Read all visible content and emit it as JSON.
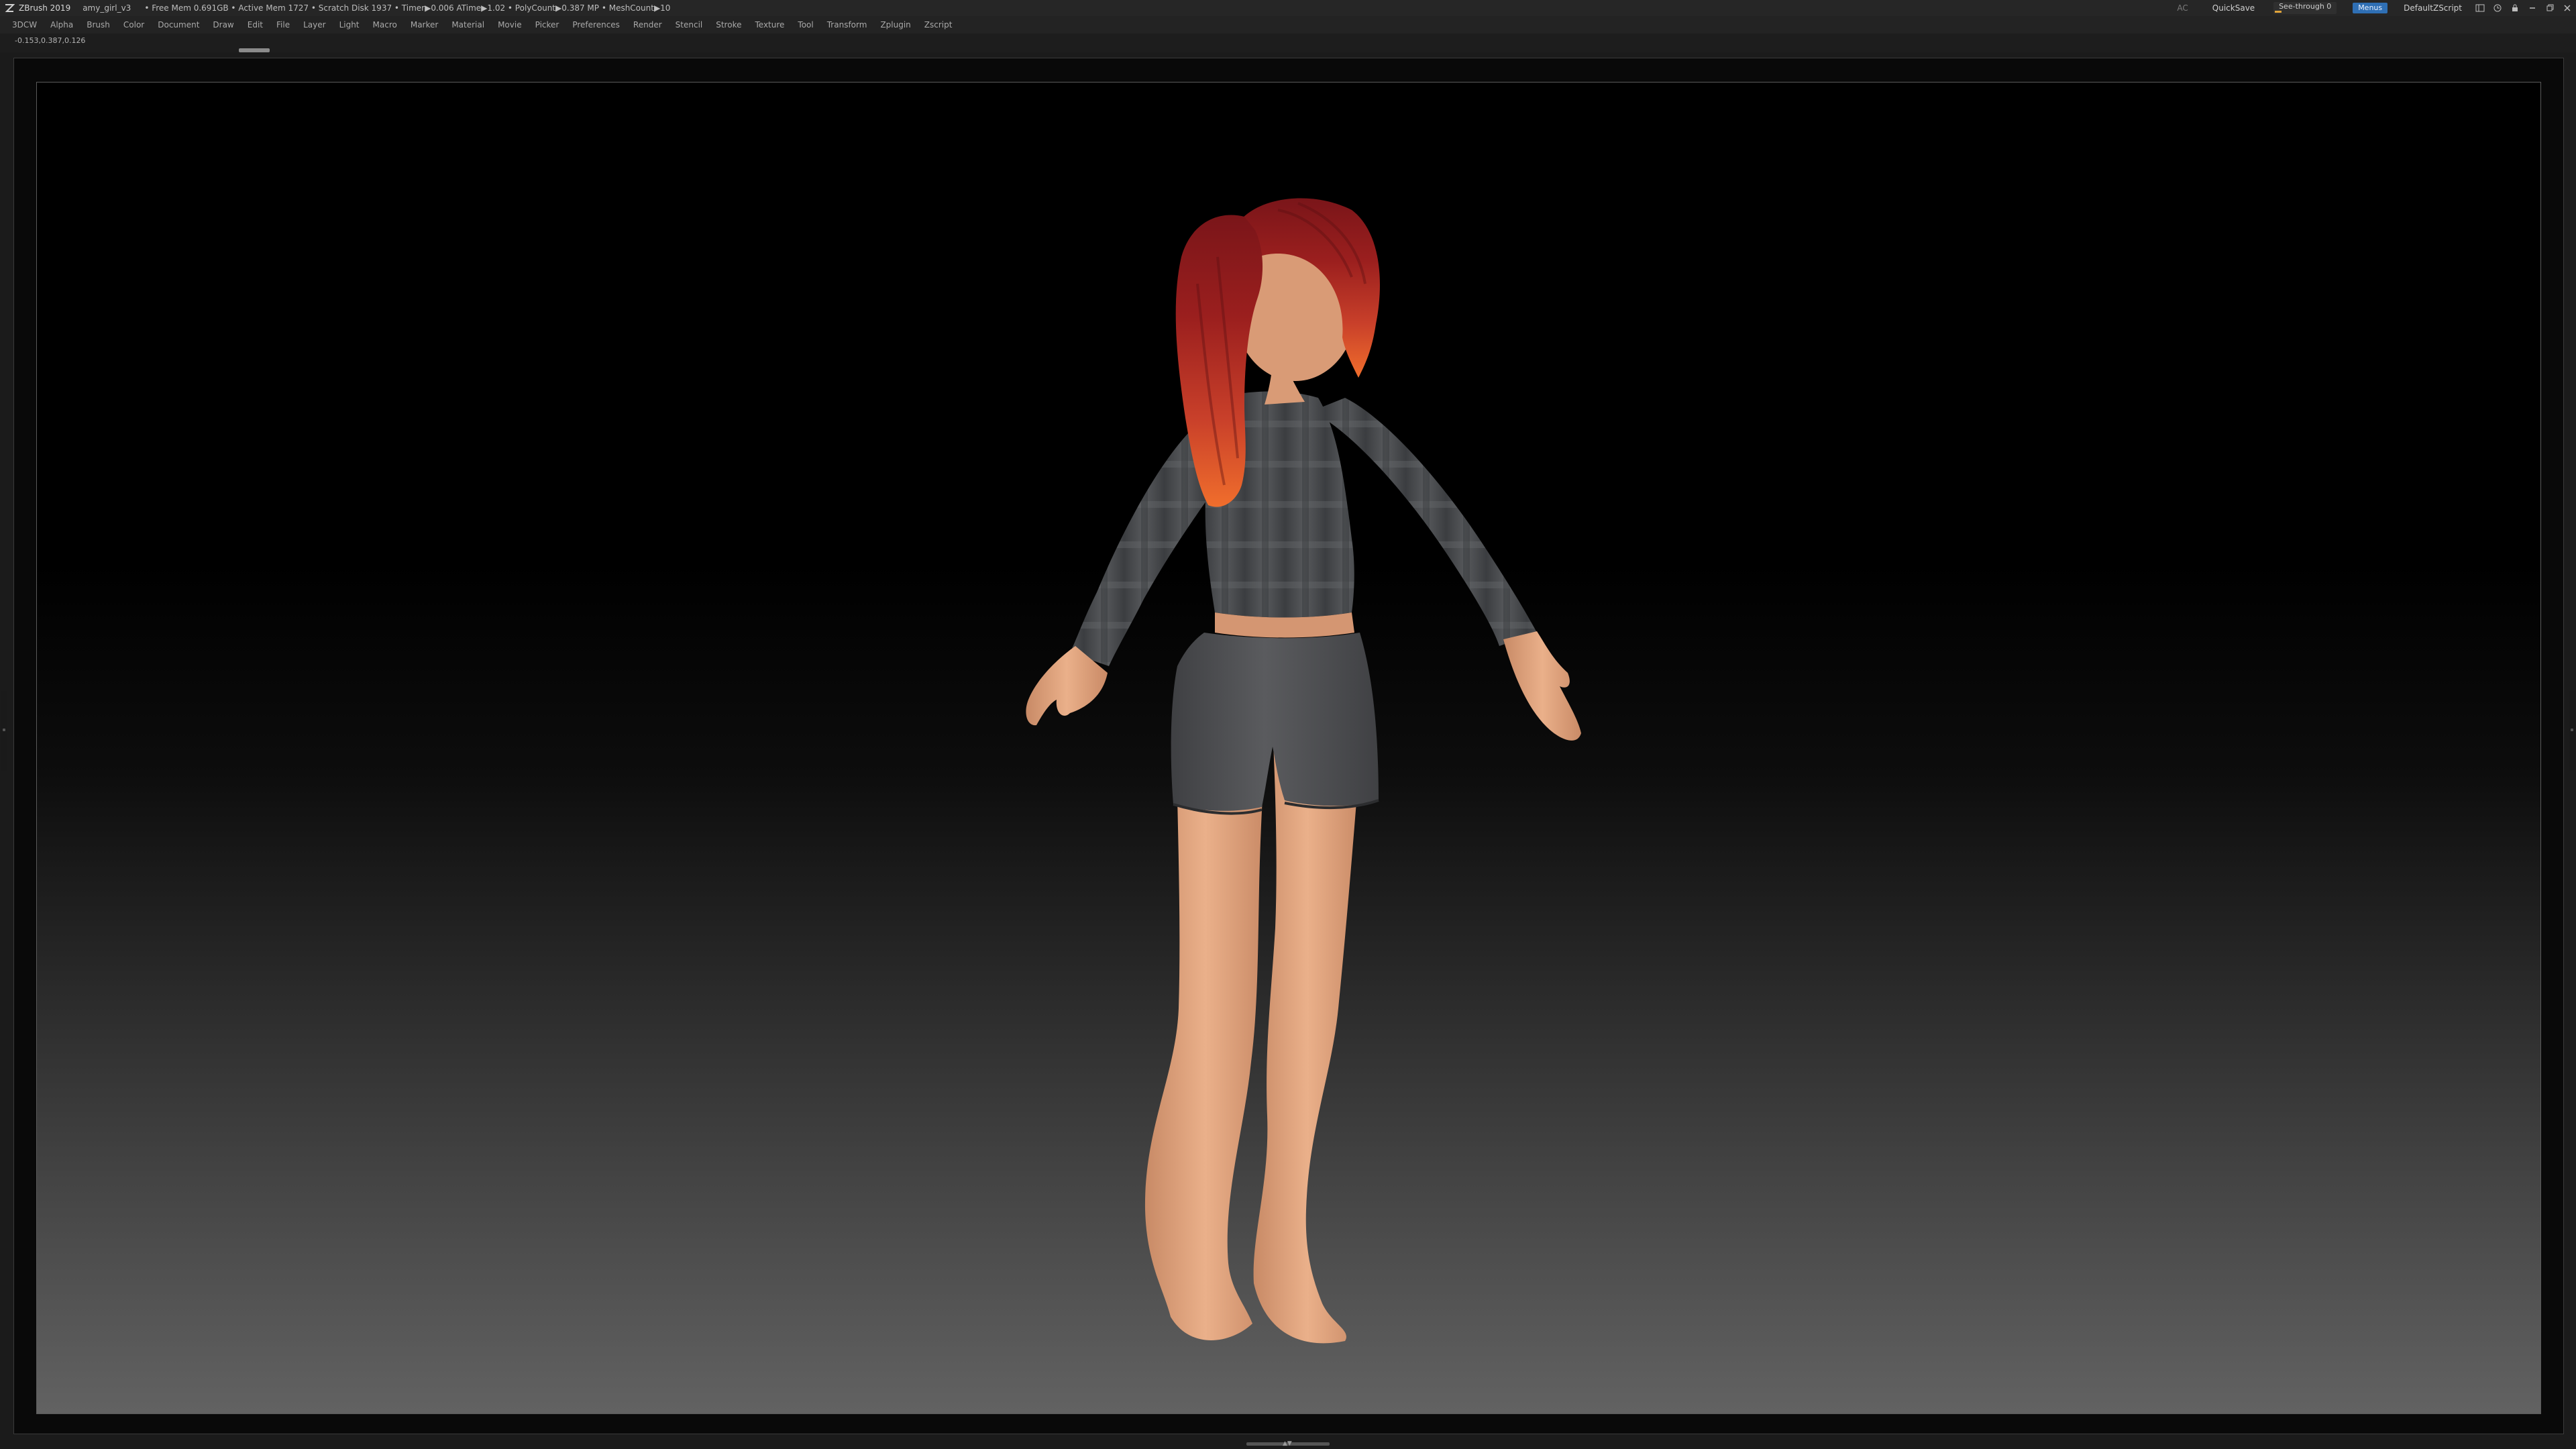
{
  "titlebar": {
    "app_name": "ZBrush 2019",
    "file_name": "amy_girl_v3",
    "stats": "• Free Mem 0.691GB • Active Mem 1727 • Scratch Disk 1937 • Timer▶0.006 ATime▶1.02 • PolyCount▶0.387 MP • MeshCount▶10",
    "ac_label": "AC",
    "quicksave_label": "QuickSave",
    "seethrough_label": "See-through  0",
    "menus_label": "Menus",
    "script_label": "DefaultZScript",
    "seethrough_value": 0
  },
  "menubar": {
    "items": [
      "3DCW",
      "Alpha",
      "Brush",
      "Color",
      "Document",
      "Draw",
      "Edit",
      "File",
      "Layer",
      "Light",
      "Macro",
      "Marker",
      "Material",
      "Movie",
      "Picker",
      "Preferences",
      "Render",
      "Stencil",
      "Stroke",
      "Texture",
      "Tool",
      "Transform",
      "Zplugin",
      "Zscript"
    ]
  },
  "viewport": {
    "coordinates": "-0.153,0.387,0.126"
  },
  "icons": {
    "logo": "zbrush-logo-icon",
    "window": [
      "layout-icon",
      "history-icon",
      "lock-icon",
      "minimize-icon",
      "restore-icon",
      "close-icon"
    ]
  },
  "colors": {
    "menus_button": "#2f6fb4",
    "seethrough_bar": "#e0a43a",
    "hair_top": "#8a1a1e",
    "hair_tips": "#e8622a",
    "shirt": "#4b4d50",
    "shorts": "#4e4f52",
    "skin": "#e0a27c"
  }
}
